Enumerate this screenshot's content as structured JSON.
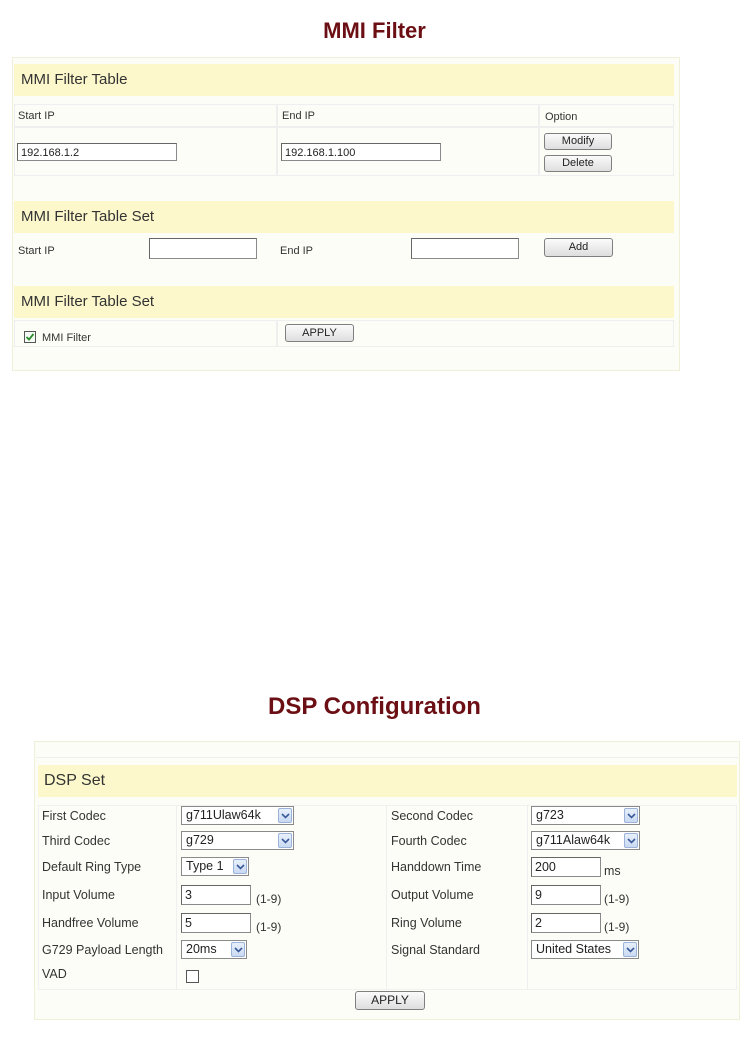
{
  "mmi": {
    "title": "MMI Filter",
    "table": {
      "heading": "MMI Filter Table",
      "col_start": "Start IP",
      "col_end": "End IP",
      "col_option": "Option",
      "row_start_ip": "192.168.1.2",
      "row_end_ip": "192.168.1.100",
      "modify_label": "Modify",
      "delete_label": "Delete"
    },
    "table_set": {
      "heading": "MMI Filter Table Set",
      "start_label": "Start IP",
      "end_label": "End IP",
      "start_value": "",
      "end_value": "",
      "add_label": "Add"
    },
    "enable_set": {
      "heading": "MMI Filter Table Set",
      "checkbox_label": "MMI Filter",
      "checked": true,
      "apply_label": "APPLY"
    }
  },
  "dsp": {
    "title": "DSP Configuration",
    "heading": "DSP Set",
    "first_codec_label": "First Codec",
    "first_codec_value": "g711Ulaw64k",
    "second_codec_label": "Second Codec",
    "second_codec_value": "g723",
    "third_codec_label": "Third Codec",
    "third_codec_value": "g729",
    "fourth_codec_label": "Fourth Codec",
    "fourth_codec_value": "g711Alaw64k",
    "ring_type_label": "Default Ring Type",
    "ring_type_value": "Type 1",
    "handdown_label": "Handdown Time",
    "handdown_value": "200",
    "handdown_unit": "ms",
    "input_volume_label": "Input Volume",
    "input_volume_value": "3",
    "output_volume_label": "Output Volume",
    "output_volume_value": "9",
    "handfree_volume_label": "Handfree Volume",
    "handfree_volume_value": "5",
    "ring_volume_label": "Ring Volume",
    "ring_volume_value": "2",
    "range_hint": "(1-9)",
    "payload_label": "G729 Payload Length",
    "payload_value": "20ms",
    "signal_label": "Signal Standard",
    "signal_value": "United States",
    "vad_label": "VAD",
    "vad_checked": false,
    "apply_label": "APPLY"
  },
  "colors": {
    "title": "#6b0f14",
    "band": "#fcf8cc"
  }
}
